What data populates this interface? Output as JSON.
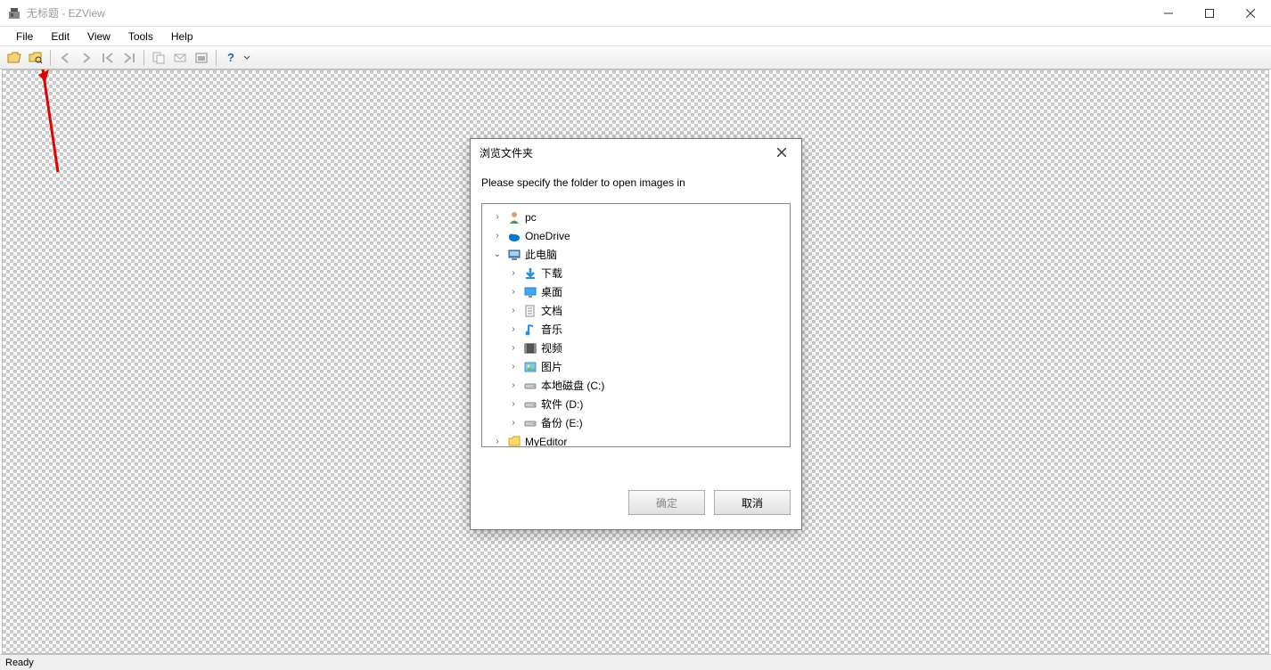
{
  "titlebar": {
    "title": "无标题 - EZView"
  },
  "menubar": {
    "items": [
      "File",
      "Edit",
      "View",
      "Tools",
      "Help"
    ]
  },
  "statusbar": {
    "text": "Ready"
  },
  "dialog": {
    "title": "浏览文件夹",
    "instruction": "Please specify the folder to open images in",
    "ok_label": "确定",
    "cancel_label": "取消",
    "tree": [
      {
        "depth": 0,
        "expand": "›",
        "icon": "user",
        "label": "pc"
      },
      {
        "depth": 0,
        "expand": "›",
        "icon": "onedrive",
        "label": "OneDrive"
      },
      {
        "depth": 0,
        "expand": "v",
        "icon": "computer",
        "label": "此电脑"
      },
      {
        "depth": 1,
        "expand": "›",
        "icon": "download",
        "label": "下载"
      },
      {
        "depth": 1,
        "expand": "›",
        "icon": "desktop",
        "label": "桌面"
      },
      {
        "depth": 1,
        "expand": "›",
        "icon": "document",
        "label": "文档"
      },
      {
        "depth": 1,
        "expand": "›",
        "icon": "music",
        "label": "音乐"
      },
      {
        "depth": 1,
        "expand": "›",
        "icon": "video",
        "label": "视频"
      },
      {
        "depth": 1,
        "expand": "›",
        "icon": "picture",
        "label": "图片"
      },
      {
        "depth": 1,
        "expand": "›",
        "icon": "drive",
        "label": "本地磁盘 (C:)"
      },
      {
        "depth": 1,
        "expand": "›",
        "icon": "drive",
        "label": "软件 (D:)"
      },
      {
        "depth": 1,
        "expand": "›",
        "icon": "drive",
        "label": "备份 (E:)"
      },
      {
        "depth": 0,
        "expand": "›",
        "icon": "folder",
        "label": "MyEditor"
      }
    ]
  }
}
